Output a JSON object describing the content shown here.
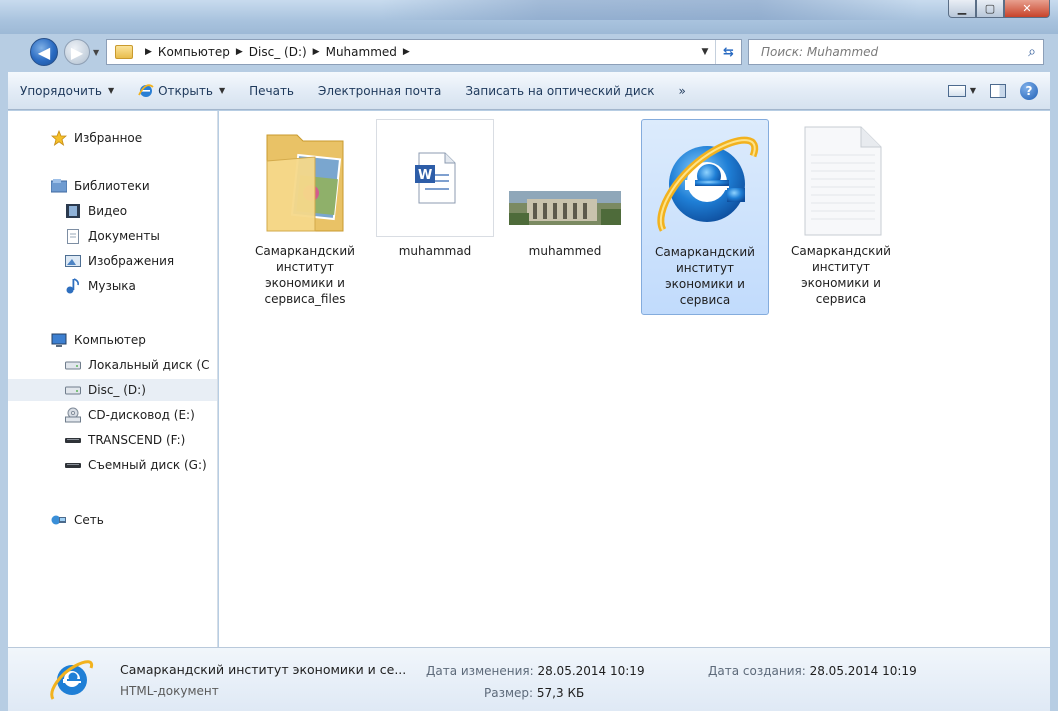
{
  "address": {
    "crumbs": [
      "Компьютер",
      "Disc_ (D:)",
      "Muhammed"
    ],
    "search_placeholder": "Поиск: Muhammed"
  },
  "toolbar": {
    "organize": "Упорядочить",
    "open": "Открыть",
    "print": "Печать",
    "email": "Электронная почта",
    "burn": "Записать на оптический диск",
    "more": "»"
  },
  "navpane": {
    "favorites": "Избранное",
    "libraries": "Библиотеки",
    "video": "Видео",
    "documents": "Документы",
    "images": "Изображения",
    "music": "Музыка",
    "computer": "Компьютер",
    "local_disk": "Локальный диск (C",
    "disc_d": "Disc_ (D:)",
    "cd_drive": "CD-дисковод (E:)",
    "transcend": "TRANSCEND (F:)",
    "removable": "Съемный диск (G:)",
    "network": "Сеть"
  },
  "files": [
    {
      "label": "Самаркандский институт экономики и сервиса_files",
      "icon": "folder-with-photos-icon"
    },
    {
      "label": "muhammad",
      "icon": "word-document-icon"
    },
    {
      "label": "muhammed",
      "icon": "photo-thumbnail"
    },
    {
      "label": "Самаркандский институт экономики и сервиса",
      "icon": "internet-explorer-icon",
      "selected": true
    },
    {
      "label": "Самаркандский институт экономики и сервиса",
      "icon": "blank-document-icon"
    }
  ],
  "details": {
    "name": "Самаркандский институт экономики и се...",
    "type": "HTML-документ",
    "modified_label": "Дата изменения:",
    "modified_value": "28.05.2014 10:19",
    "created_label": "Дата создания:",
    "created_value": "28.05.2014 10:19",
    "size_label": "Размер:",
    "size_value": "57,3 КБ"
  },
  "colors": {
    "selection": "#c1dbfc",
    "accent": "#2a6bc2",
    "ie_blue": "#1f6fc8",
    "ie_gold": "#f2b21e"
  }
}
